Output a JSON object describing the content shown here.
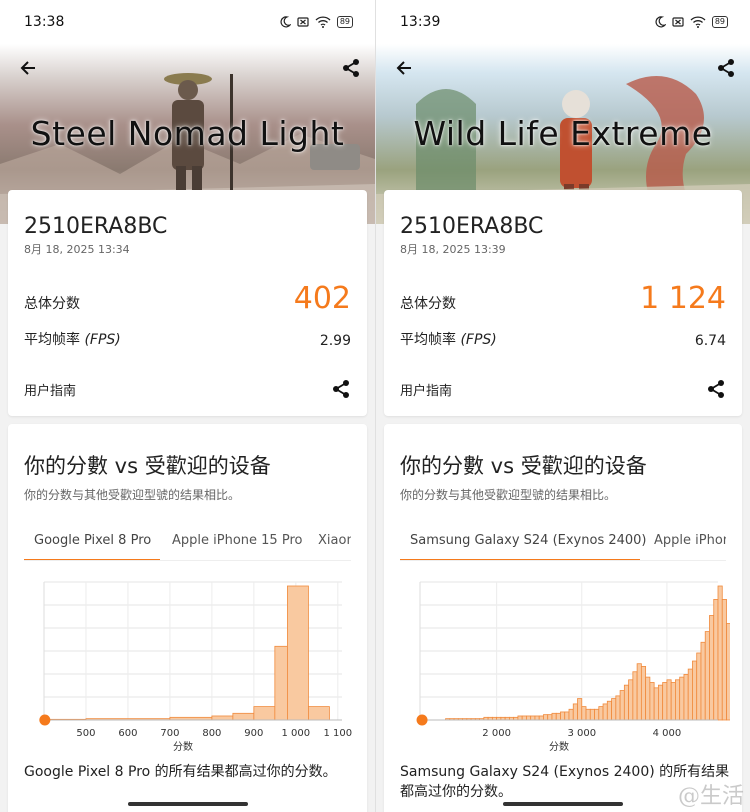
{
  "left": {
    "status_time": "13:38",
    "battery": "89",
    "benchmark_title": "Steel Nomad Light",
    "device_model": "2510ERA8BC",
    "datetime": "8月 18, 2025 13:34",
    "total_score_label": "总体分数",
    "total_score": "402",
    "avg_fps_label": "平均帧率",
    "fps_unit": "(FPS)",
    "avg_fps": "2.99",
    "user_guide": "用户指南",
    "compare_title": "你的分數 vs 受歡迎的设备",
    "compare_sub": "你的分数与其他受歡迎型號的结果相比。",
    "tabs": [
      "Google Pixel 8 Pro",
      "Apple iPhone 15 Pro",
      "Xiaon"
    ],
    "active_tab": 0,
    "footnote": "Google Pixel 8 Pro 的所有结果都高过你的分数。"
  },
  "right": {
    "status_time": "13:39",
    "battery": "89",
    "benchmark_title": "Wild Life Extreme",
    "device_model": "2510ERA8BC",
    "datetime": "8月 18, 2025 13:39",
    "total_score_label": "总体分数",
    "total_score": "1 124",
    "avg_fps_label": "平均帧率",
    "fps_unit": "(FPS)",
    "avg_fps": "6.74",
    "user_guide": "用户指南",
    "compare_title": "你的分數 vs 受歡迎的设备",
    "compare_sub": "你的分数与其他受歡迎型號的结果相比。",
    "tabs": [
      "Samsung Galaxy S24 (Exynos 2400)",
      "Apple iPhon"
    ],
    "active_tab": 0,
    "footnote": "Samsung Galaxy S24 (Exynos 2400) 的所有结果都高过你的分数。"
  },
  "watermark": "生活",
  "colors": {
    "accent": "#f57a1c",
    "bar_fill": "#f9c9a0",
    "bar_stroke": "#f08a3c"
  },
  "chart_data": [
    {
      "type": "bar",
      "xlabel": "分数",
      "tick_labels": [
        "500",
        "600",
        "700",
        "800",
        "900",
        "1 000",
        "1 100"
      ],
      "xlim": [
        400,
        1110
      ],
      "user_score": 402,
      "bins": [
        {
          "x0": 400,
          "x1": 500,
          "v": 0.5
        },
        {
          "x0": 500,
          "x1": 700,
          "v": 1
        },
        {
          "x0": 700,
          "x1": 800,
          "v": 2
        },
        {
          "x0": 800,
          "x1": 850,
          "v": 3
        },
        {
          "x0": 850,
          "x1": 900,
          "v": 5
        },
        {
          "x0": 900,
          "x1": 950,
          "v": 10
        },
        {
          "x0": 950,
          "x1": 980,
          "v": 55
        },
        {
          "x0": 980,
          "x1": 1030,
          "v": 100
        },
        {
          "x0": 1030,
          "x1": 1080,
          "v": 10
        }
      ]
    },
    {
      "type": "bar",
      "xlabel": "分数",
      "tick_labels": [
        "2 000",
        "3 000",
        "4 000"
      ],
      "xlim": [
        1100,
        4600
      ],
      "user_score": 1124,
      "bins_start": 1400,
      "bin_width": 50,
      "values": [
        1,
        1,
        1,
        1,
        1,
        1,
        1,
        1,
        1,
        2,
        2,
        2,
        2,
        2,
        2,
        2,
        2,
        3,
        3,
        3,
        3,
        3,
        3,
        4,
        4,
        5,
        5,
        6,
        6,
        8,
        12,
        16,
        10,
        8,
        8,
        8,
        10,
        12,
        14,
        16,
        18,
        22,
        26,
        30,
        36,
        42,
        40,
        32,
        28,
        24,
        26,
        28,
        30,
        28,
        30,
        32,
        34,
        38,
        44,
        50,
        58,
        66,
        78,
        90,
        100,
        90,
        72,
        52,
        30,
        10,
        6,
        3
      ]
    }
  ]
}
